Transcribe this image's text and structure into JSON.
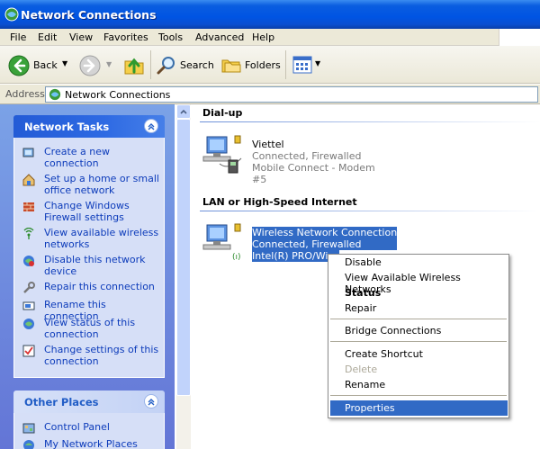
{
  "window": {
    "title": "Network Connections"
  },
  "menu": [
    "File",
    "Edit",
    "View",
    "Favorites",
    "Tools",
    "Advanced",
    "Help"
  ],
  "toolbar": {
    "back": "Back",
    "search": "Search",
    "folders": "Folders"
  },
  "address": {
    "label": "Address",
    "value": "Network Connections"
  },
  "network_tasks": {
    "title": "Network Tasks",
    "items": [
      "Create a new connection",
      "Set up a home or small office network",
      "Change Windows Firewall settings",
      "View available wireless networks",
      "Disable this network device",
      "Repair this connection",
      "Rename this connection",
      "View status of this connection",
      "Change settings of this connection"
    ]
  },
  "other_places": {
    "title": "Other Places",
    "items": [
      "Control Panel",
      "My Network Places"
    ]
  },
  "groups": {
    "dialup": {
      "title": "Dial-up",
      "name": "Viettel",
      "status": "Connected, Firewalled",
      "device": "Mobile Connect - Modem #5"
    },
    "lan": {
      "title": "LAN or High-Speed Internet",
      "name": "Wireless Network Connection",
      "status": "Connected, Firewalled",
      "device": "Intel(R) PRO/Wire"
    }
  },
  "context_menu": {
    "items": [
      "Disable",
      "View Available Wireless Networks",
      "Status",
      "Repair",
      "Bridge Connections",
      "Create Shortcut",
      "Delete",
      "Rename",
      "Properties"
    ]
  },
  "colors": {
    "accent": "#316ac5",
    "titlebar": "#0054e3",
    "task_link": "#0c3bba"
  }
}
